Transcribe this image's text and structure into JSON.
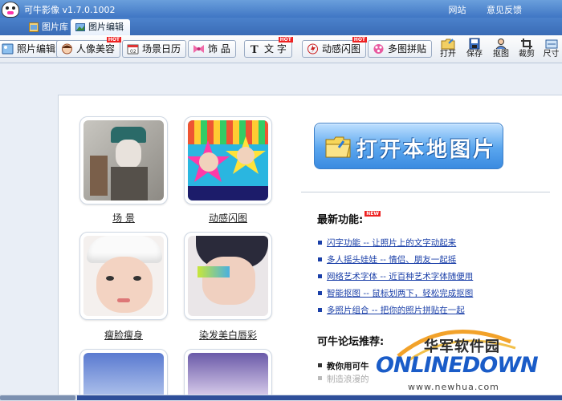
{
  "app": {
    "title": "可牛影像 v1.7.0.1002",
    "links": [
      "网站",
      "意见反馈"
    ]
  },
  "tabs": [
    {
      "label": "图片库",
      "active": false
    },
    {
      "label": "图片编辑",
      "active": true
    }
  ],
  "toolbar": {
    "buttons": [
      {
        "label": "照片编辑",
        "icon": "photo-edit-icon",
        "hot": false
      },
      {
        "label": "人像美容",
        "icon": "face-icon",
        "hot": true
      },
      {
        "label": "场景日历",
        "icon": "calendar-icon",
        "hot": false
      },
      {
        "label": "饰 品",
        "icon": "bow-icon",
        "hot": false
      },
      {
        "label": "文 字",
        "icon": "text-icon",
        "hot": true
      },
      {
        "label": "动感闪图",
        "icon": "flash-icon",
        "hot": true
      },
      {
        "label": "多图拼贴",
        "icon": "collage-icon",
        "hot": false
      }
    ],
    "hot_label": "HOT",
    "actions": [
      {
        "label": "打开",
        "icon": "open-icon"
      },
      {
        "label": "保存",
        "icon": "save-icon"
      },
      {
        "label": "抠图",
        "icon": "cutout-icon"
      },
      {
        "label": "裁剪",
        "icon": "crop-icon"
      },
      {
        "label": "尺寸",
        "icon": "resize-icon"
      }
    ]
  },
  "gallery": [
    {
      "label": "场 景"
    },
    {
      "label": "动感闪图"
    },
    {
      "label": "瘦脸瘦身"
    },
    {
      "label": "染发美白唇彩"
    }
  ],
  "open_local": "打开本地图片",
  "new_features": {
    "title": "最新功能:",
    "badge": "NEW",
    "items": [
      "闪字功能 -- 让照片上的文字动起来",
      "多人摇头娃娃 -- 情侣、朋友一起摇",
      "网络艺术字体 -- 近百种艺术字体随便用",
      "智能抠图 -- 鼠标划两下，轻松完成抠图",
      "多照片组合 -- 把你的照片拼贴在一起"
    ]
  },
  "forum": {
    "title": "可牛论坛推荐:",
    "items": [
      "教你用可牛",
      "制造浪漫的"
    ]
  },
  "watermark": {
    "top": "华军软件园",
    "brand": "ONLINEDOWN",
    "url": "www.newhua.com"
  },
  "colors": {
    "titlebar": "#3f76c4",
    "link": "#1a3fa8",
    "open_button": "#5aa6ee",
    "hot_badge": "#e22222"
  }
}
